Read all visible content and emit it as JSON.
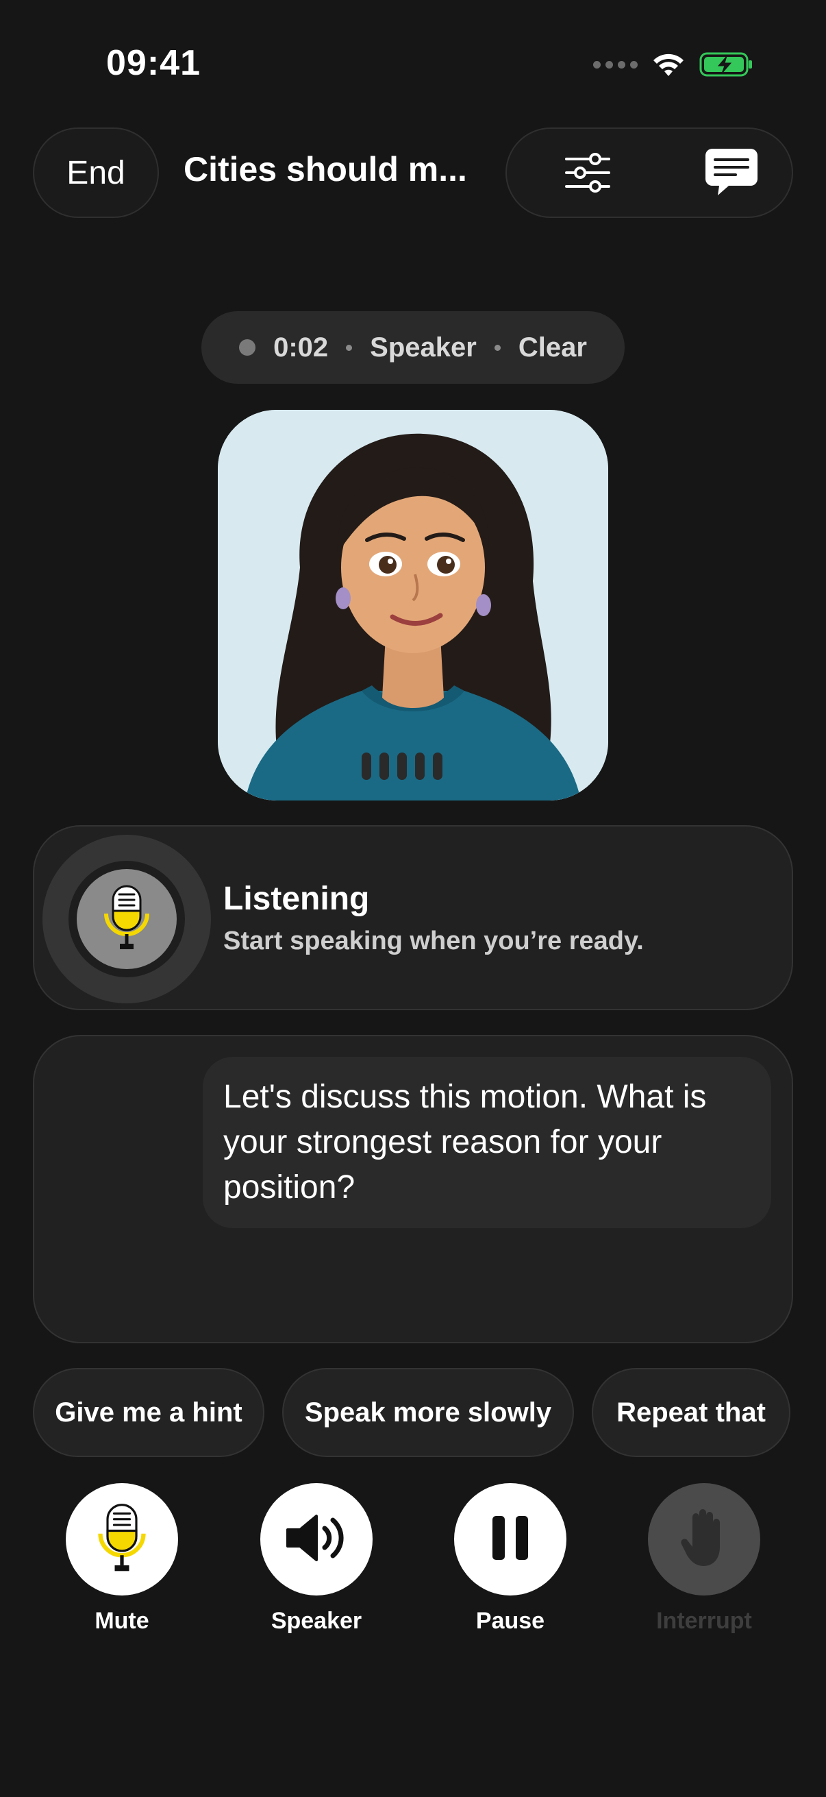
{
  "status_bar": {
    "time": "09:41"
  },
  "header": {
    "end_label": "End",
    "title": "Cities should m...",
    "settings_icon": "sliders-icon",
    "chat_icon": "chat-bubble-icon"
  },
  "session": {
    "timer": "0:02",
    "mode": "Speaker",
    "state": "Clear"
  },
  "listening": {
    "title": "Listening",
    "subtitle": "Start speaking when you’re ready."
  },
  "transcript": {
    "message": "Let's discuss this motion. What is your strongest reason for your position?"
  },
  "quick_replies": [
    {
      "label": "Give me a hint"
    },
    {
      "label": "Speak more slowly"
    },
    {
      "label": "Repeat that"
    }
  ],
  "controls": [
    {
      "label": "Mute",
      "icon": "microphone-icon",
      "enabled": true
    },
    {
      "label": "Speaker",
      "icon": "speaker-icon",
      "enabled": true
    },
    {
      "label": "Pause",
      "icon": "pause-icon",
      "enabled": true
    },
    {
      "label": "Interrupt",
      "icon": "hand-icon",
      "enabled": false
    }
  ],
  "colors": {
    "background": "#161616",
    "card": "#212121",
    "mic_yellow": "#f5d800",
    "battery_green": "#34c759"
  }
}
